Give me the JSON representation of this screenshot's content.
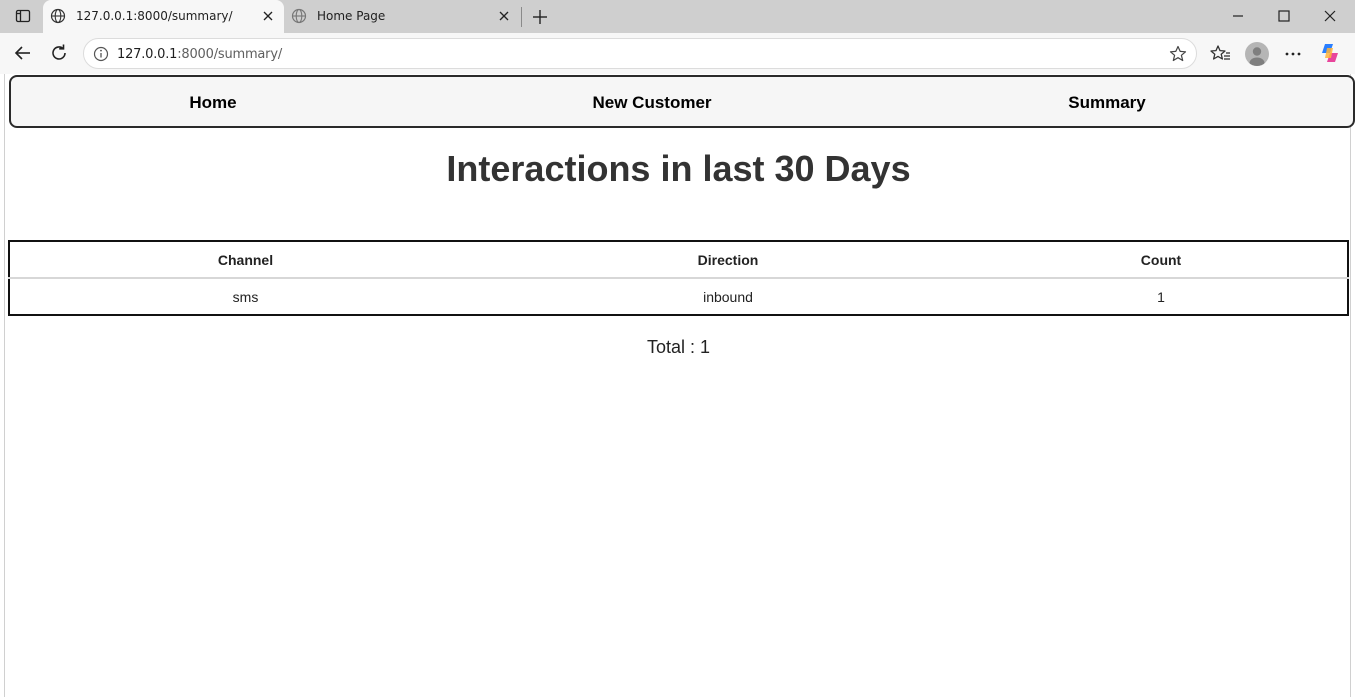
{
  "browser": {
    "tabs": [
      {
        "title": "127.0.0.1:8000/summary/",
        "active": true
      },
      {
        "title": "Home Page",
        "active": false
      }
    ],
    "address": {
      "host": "127.0.0.1",
      "rest": ":8000/summary/"
    }
  },
  "nav": {
    "home": "Home",
    "new_customer": "New Customer",
    "summary": "Summary"
  },
  "page": {
    "title": "Interactions in last 30 Days",
    "table": {
      "headers": [
        "Channel",
        "Direction",
        "Count"
      ],
      "rows": [
        [
          "sms",
          "inbound",
          "1"
        ]
      ]
    },
    "total": "Total : 1"
  },
  "icons": {
    "tab_actions": "tab-actions-icon",
    "globe": "globe-icon",
    "close": "close-icon",
    "new_tab": "plus-icon",
    "minimize": "minimize-icon",
    "maximize": "maximize-icon",
    "window_close": "window-close-icon",
    "back": "back-arrow-icon",
    "reload": "reload-icon",
    "info": "info-icon",
    "favorite": "star-icon",
    "favorites": "favorites-icon",
    "profile": "profile-icon",
    "more": "more-icon",
    "copilot": "copilot-icon"
  },
  "colors": {
    "tabstrip_bg": "#cfcfcf",
    "toolbar_bg": "#f7f7f7",
    "nav_bg": "#f6f6f6",
    "title_text": "#333333"
  }
}
